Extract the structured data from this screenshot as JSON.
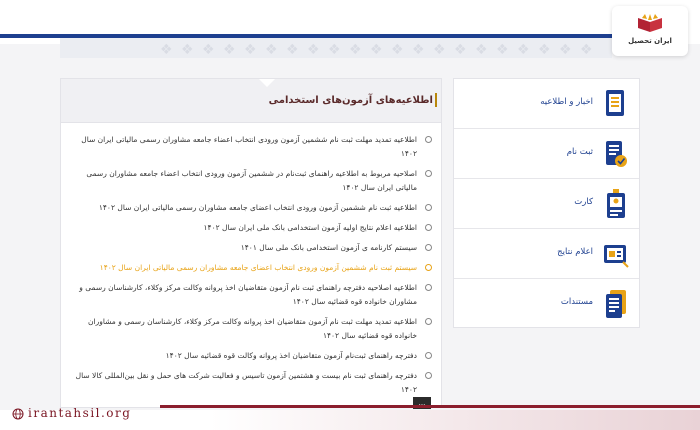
{
  "header": {
    "logo_text": "ایران تحصیل"
  },
  "main": {
    "title": "اطلاعیه‌های آزمون‌های استخدامی",
    "more_label": "...",
    "items": [
      {
        "text": "اطلاعیه تمدید مهلت ثبت نام ششمین آزمون ورودی انتخاب اعضاء جامعه مشاوران رسمی مالیاتی ایران سال ۱۴۰۲",
        "active": false
      },
      {
        "text": "اصلاحیه مربوط به اطلاعیه راهنمای ثبت‌نام در ششمین آزمون ورودی انتخاب اعضاء جامعه مشاوران رسمی مالیاتی ایران سال ۱۴۰۲",
        "active": false
      },
      {
        "text": "اطلاعیه ثبت نام ششمین آزمون ورودی انتخاب اعضای جامعه مشاوران رسمی مالیاتی ایران سال ۱۴۰۲",
        "active": false
      },
      {
        "text": "اطلاعیه اعلام نتایج اولیه آزمون استخدامی بانک ملی ایران سال ۱۴۰۲",
        "active": false
      },
      {
        "text": "سیستم کارنامه ی آزمون استخدامی بانک ملی سال ۱۴۰۱",
        "active": false
      },
      {
        "text": "سیستم ثبت نام ششمین آزمون ورودی انتخاب اعضای جامعه مشاوران رسمی مالیاتی ایران سال ۱۴۰۲",
        "active": true
      },
      {
        "text": "اطلاعیه  اصلاحیه دفترچه راهنمای ثبت نام آزمون متقاضیان اخذ پروانه وکالت مرکز وکلاء، کارشناسان رسمی و مشاوران خانواده قوه قضائیه سال ۱۴۰۲",
        "active": false
      },
      {
        "text": "اطلاعیه تمدید مهلت ثبت نام آزمون متقاضیان اخذ پروانه وکالت مرکز وکلاء، کارشناسان رسمی و مشاوران خانواده قوه قضائیه سال ۱۴۰۲",
        "active": false
      },
      {
        "text": "دفترچه راهنمای ثبت‌نام آزمون متقاضیان اخذ پروانه وکالت قوه قضائیه سال ۱۴۰۲",
        "active": false
      },
      {
        "text": "دفترچه راهنمای ثبت نام  بیست و هشتمین آزمون تاسیس و فعالیت شرکت های حمل و نقل بین‌المللی کالا سال ۱۴۰۲",
        "active": false
      }
    ]
  },
  "sidebar": {
    "items": [
      {
        "label": "اخبار و اطلاعیه",
        "icon": "news-icon"
      },
      {
        "label": "ثبت نام",
        "icon": "register-icon"
      },
      {
        "label": "کارت",
        "icon": "id-card-icon"
      },
      {
        "label": "اعلام نتایج",
        "icon": "results-icon"
      },
      {
        "label": "مستندات",
        "icon": "documents-icon"
      }
    ]
  },
  "footer": {
    "brand": "irantahsil.org"
  },
  "colors": {
    "accent_blue": "#1d3f8f",
    "active_orange": "#e8a317",
    "brand_red": "#8b1e2d"
  }
}
